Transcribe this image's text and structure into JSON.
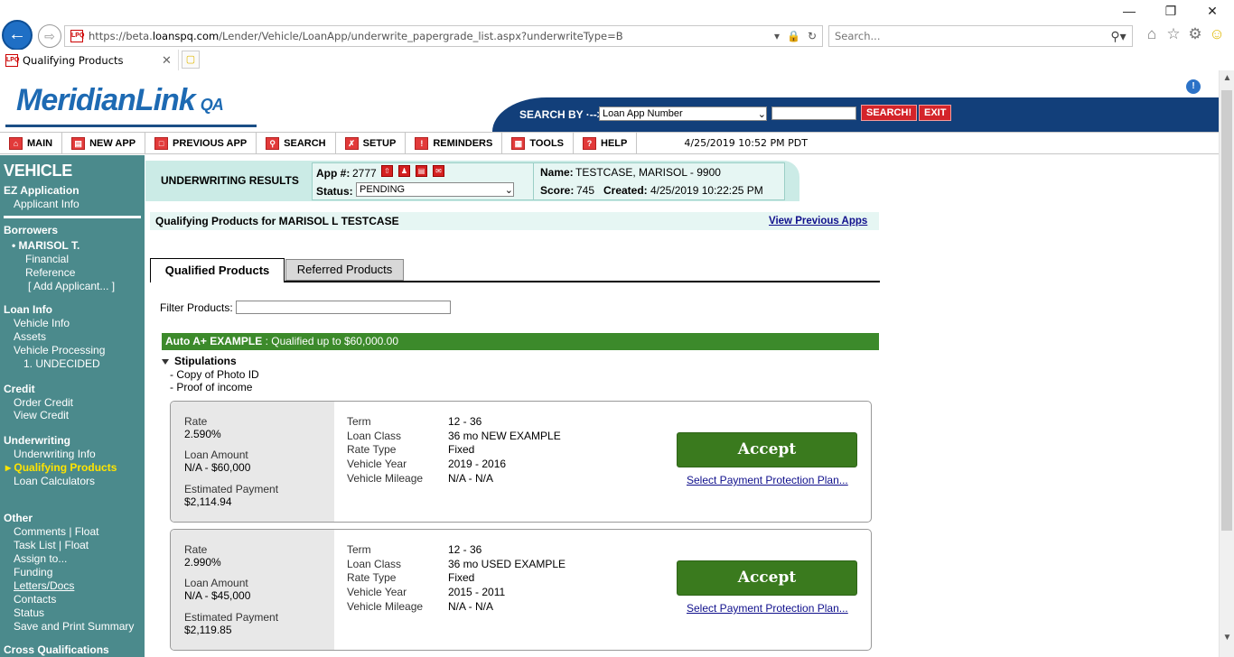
{
  "browser": {
    "url_prefix": "https://beta.",
    "url_domain": "loanspq.com",
    "url_path": "/Lender/Vehicle/LoanApp/underwrite_papergrade_list.aspx?underwriteType=B",
    "search_placeholder": "Search...",
    "tab_title": "Qualifying Products",
    "favicon_text": "LPQ"
  },
  "header": {
    "logo": "MeridianLink",
    "logo_suffix": "QA",
    "search_by_label": "SEARCH BY ·-->",
    "search_by_value": "Loan App Number",
    "search_button": "SEARCH!",
    "exit_button": "EXIT"
  },
  "menu": {
    "items": [
      "MAIN",
      "NEW APP",
      "PREVIOUS APP",
      "SEARCH",
      "SETUP",
      "REMINDERS",
      "TOOLS",
      "HELP"
    ],
    "datetime": "4/25/2019 10:52 PM PDT"
  },
  "sidebar": {
    "title": "VEHICLE",
    "ez_application": "EZ Application",
    "applicant_info": "Applicant Info",
    "borrowers": "Borrowers",
    "borrower_name": "MARISOL T.",
    "financial": "Financial",
    "reference": "Reference",
    "add_applicant": "[ Add Applicant... ]",
    "loan_info": "Loan Info",
    "vehicle_info": "Vehicle Info",
    "assets": "Assets",
    "vehicle_processing": "Vehicle Processing",
    "undecided": "1. UNDECIDED",
    "credit": "Credit",
    "order_credit": "Order Credit",
    "view_credit": "View Credit",
    "underwriting": "Underwriting",
    "underwriting_info": "Underwriting Info",
    "qualifying_products": "Qualifying Products",
    "loan_calculators": "Loan Calculators",
    "other": "Other",
    "comments": "Comments | Float",
    "task_list": "Task List | Float",
    "assign_to": "Assign to...",
    "funding": "Funding",
    "letters_docs": "Letters/Docs",
    "contacts": "Contacts",
    "status": "Status",
    "save_print": "Save and Print Summary",
    "cross_qualifications": "Cross Qualifications"
  },
  "uw": {
    "title": "UNDERWRITING RESULTS",
    "app_label": "App #:",
    "app_number": "2777",
    "status_label": "Status:",
    "status_value": "PENDING",
    "name_label": "Name:",
    "name_value": "TESTCASE, MARISOL  -  9900",
    "score_label": "Score:",
    "score_value": "745",
    "created_label": "Created:",
    "created_value": "4/25/2019 10:22:25 PM"
  },
  "qp": {
    "title": "Qualifying Products for MARISOL L TESTCASE",
    "view_previous": "View Previous Apps",
    "tab_qualified": "Qualified Products",
    "tab_referred": "Referred Products",
    "filter_label": "Filter Products:",
    "program_name": "Auto A+ EXAMPLE",
    "program_desc": " : Qualified up to $60,000.00",
    "stipulations_label": "Stipulations",
    "stipulations": [
      "-   Copy of Photo ID",
      "-   Proof of income"
    ]
  },
  "products": [
    {
      "rate_label": "Rate",
      "rate": "2.590%",
      "loan_amount_label": "Loan Amount",
      "loan_amount": "N/A - $60,000",
      "est_payment_label": "Estimated Payment",
      "est_payment": "$2,114.94",
      "term_label": "Term",
      "term": "12 - 36",
      "loan_class_label": "Loan Class",
      "loan_class": "36 mo NEW EXAMPLE",
      "rate_type_label": "Rate Type",
      "rate_type": "Fixed",
      "vehicle_year_label": "Vehicle Year",
      "vehicle_year": "2019 - 2016",
      "vehicle_mileage_label": "Vehicle Mileage",
      "vehicle_mileage": "N/A - N/A",
      "accept": "Accept",
      "ppp": "Select Payment Protection Plan..."
    },
    {
      "rate_label": "Rate",
      "rate": "2.990%",
      "loan_amount_label": "Loan Amount",
      "loan_amount": "N/A - $45,000",
      "est_payment_label": "Estimated Payment",
      "est_payment": "$2,119.85",
      "term_label": "Term",
      "term": "12 - 36",
      "loan_class_label": "Loan Class",
      "loan_class": "36 mo USED EXAMPLE",
      "rate_type_label": "Rate Type",
      "rate_type": "Fixed",
      "vehicle_year_label": "Vehicle Year",
      "vehicle_year": "2015 - 2011",
      "vehicle_mileage_label": "Vehicle Mileage",
      "vehicle_mileage": "N/A - N/A",
      "accept": "Accept",
      "ppp": "Select Payment Protection Plan..."
    }
  ]
}
